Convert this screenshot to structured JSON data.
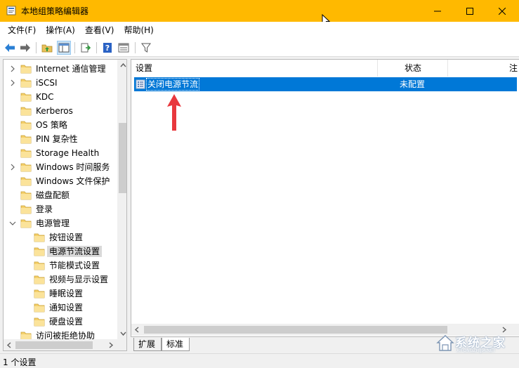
{
  "window": {
    "title": "本地组策略编辑器"
  },
  "menu": {
    "items": [
      {
        "label": "文件(F)"
      },
      {
        "label": "操作(A)"
      },
      {
        "label": "查看(V)"
      },
      {
        "label": "帮助(H)"
      }
    ]
  },
  "toolbar": {
    "icons": [
      "back-arrow-icon",
      "forward-arrow-icon",
      "up-folder-icon",
      "show-hide-tree-icon",
      "export-list-icon",
      "help-icon",
      "properties-icon",
      "filter-icon"
    ]
  },
  "tree": {
    "items": [
      {
        "label": "Internet 通信管理",
        "expandable": true
      },
      {
        "label": "iSCSI",
        "expandable": true
      },
      {
        "label": "KDC",
        "expandable": false
      },
      {
        "label": "Kerberos",
        "expandable": false
      },
      {
        "label": "OS 策略",
        "expandable": false
      },
      {
        "label": "PIN 复杂性",
        "expandable": false
      },
      {
        "label": "Storage Health",
        "expandable": false
      },
      {
        "label": "Windows 时间服务",
        "expandable": true
      },
      {
        "label": "Windows 文件保护",
        "expandable": false
      },
      {
        "label": "磁盘配额",
        "expandable": false
      },
      {
        "label": "登录",
        "expandable": false
      },
      {
        "label": "电源管理",
        "expanded": true
      },
      {
        "label": "按钮设置",
        "child": true
      },
      {
        "label": "电源节流设置",
        "child": true,
        "selected": true
      },
      {
        "label": "节能模式设置",
        "child": true
      },
      {
        "label": "视频与显示设置",
        "child": true
      },
      {
        "label": "睡眠设置",
        "child": true
      },
      {
        "label": "通知设置",
        "child": true
      },
      {
        "label": "硬盘设置",
        "child": true
      },
      {
        "label": "访问被拒绝协助",
        "expandable": false
      }
    ]
  },
  "list": {
    "columns": [
      {
        "label": "设置"
      },
      {
        "label": "状态"
      },
      {
        "label": "注"
      }
    ],
    "rows": [
      {
        "name": "关闭电源节流",
        "state": "未配置"
      }
    ]
  },
  "tabs": [
    {
      "label": "扩展"
    },
    {
      "label": "标准"
    }
  ],
  "status": {
    "text": "1 个设置"
  },
  "watermark": {
    "main": "系统之家",
    "sub": "XITONGZHIJIA.NET"
  },
  "colors": {
    "titlebar": "#ffb900",
    "selection": "#0078d7",
    "annotation_arrow": "#e8383d"
  }
}
